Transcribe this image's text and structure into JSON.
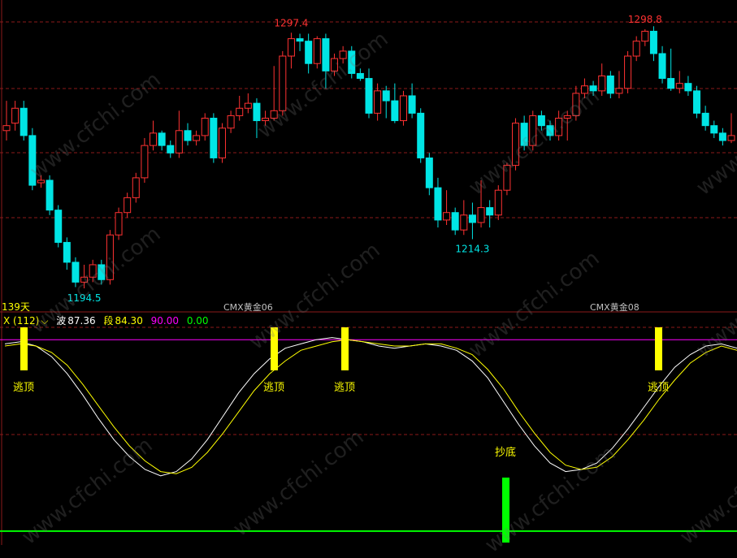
{
  "header": {
    "day_label": "139天",
    "indicator": "X (112)",
    "wave_label": "波",
    "wave_value": "87.36",
    "seg_label": "段",
    "seg_value": "84.30",
    "level_high": "90.00",
    "level_low": "0.00",
    "contracts": [
      "CMX黄金06",
      "CMX黄金08"
    ]
  },
  "watermark": "www.cfchi.com",
  "colors": {
    "up": "#ff3232",
    "down": "#00e5e5",
    "wave": "#ffffff",
    "seg": "#ffff00",
    "top_bar": "#ffff00",
    "bottom_bar": "#00ff00",
    "level90": "#ff00ff",
    "grid": "#8b1a1a"
  },
  "chart_data": [
    {
      "type": "candlestick",
      "price_labels": [
        {
          "text": "1297.4",
          "value": 1297.4,
          "kind": "high"
        },
        {
          "text": "1194.5",
          "value": 1194.5,
          "kind": "low"
        },
        {
          "text": "1214.3",
          "value": 1214.3,
          "kind": "low"
        },
        {
          "text": "1298.8",
          "value": 1298.8,
          "kind": "high"
        }
      ],
      "candles": [
        [
          1258,
          1260,
          1270,
          1254
        ],
        [
          1261,
          1267,
          1270,
          1258
        ],
        [
          1267,
          1256,
          1270,
          1254
        ],
        [
          1256,
          1236,
          1259,
          1234
        ],
        [
          1237,
          1238,
          1240,
          1235
        ],
        [
          1238,
          1226,
          1240,
          1224
        ],
        [
          1226,
          1213,
          1228,
          1211
        ],
        [
          1213,
          1205,
          1215,
          1202
        ],
        [
          1205,
          1197,
          1207,
          1195
        ],
        [
          1197,
          1199,
          1204,
          1194.5
        ],
        [
          1199,
          1204,
          1206,
          1197
        ],
        [
          1204,
          1198,
          1206,
          1196
        ],
        [
          1198,
          1216,
          1218,
          1196
        ],
        [
          1216,
          1225,
          1227,
          1214
        ],
        [
          1225,
          1231,
          1233,
          1223
        ],
        [
          1231,
          1239,
          1241,
          1229
        ],
        [
          1239,
          1252,
          1255,
          1237
        ],
        [
          1252,
          1257,
          1262,
          1250
        ],
        [
          1257,
          1252,
          1258,
          1250
        ],
        [
          1252,
          1249,
          1254,
          1247
        ],
        [
          1249,
          1258,
          1266,
          1247
        ],
        [
          1258,
          1254,
          1261,
          1252
        ],
        [
          1254,
          1256,
          1258,
          1252
        ],
        [
          1256,
          1263,
          1265,
          1254
        ],
        [
          1263,
          1247,
          1265,
          1245
        ],
        [
          1247,
          1259,
          1261,
          1245
        ],
        [
          1259,
          1264,
          1266,
          1257
        ],
        [
          1264,
          1267,
          1272,
          1262
        ],
        [
          1267,
          1269,
          1273,
          1265
        ],
        [
          1269,
          1262,
          1271,
          1255
        ],
        [
          1262,
          1263,
          1266,
          1260
        ],
        [
          1263,
          1266,
          1284,
          1262
        ],
        [
          1266,
          1288,
          1290,
          1264
        ],
        [
          1288,
          1295,
          1297.4,
          1283
        ],
        [
          1295,
          1294,
          1297,
          1290
        ],
        [
          1294,
          1285,
          1297,
          1281
        ],
        [
          1285,
          1295,
          1296,
          1283
        ],
        [
          1295,
          1282,
          1297,
          1275
        ],
        [
          1282,
          1287,
          1289,
          1280
        ],
        [
          1287,
          1290,
          1292,
          1285
        ],
        [
          1290,
          1281,
          1292,
          1279
        ],
        [
          1281,
          1279,
          1283,
          1278
        ],
        [
          1279,
          1265,
          1283,
          1263
        ],
        [
          1265,
          1274,
          1277,
          1262
        ],
        [
          1274,
          1270,
          1276,
          1263
        ],
        [
          1270,
          1262,
          1277,
          1261
        ],
        [
          1262,
          1272,
          1274,
          1260
        ],
        [
          1272,
          1265,
          1277,
          1263
        ],
        [
          1265,
          1247,
          1267,
          1245
        ],
        [
          1247,
          1235,
          1249,
          1232
        ],
        [
          1235,
          1222,
          1239,
          1219
        ],
        [
          1222,
          1225,
          1234,
          1220
        ],
        [
          1225,
          1218,
          1227,
          1216
        ],
        [
          1218,
          1224,
          1230,
          1216
        ],
        [
          1224,
          1221,
          1229,
          1214.3
        ],
        [
          1221,
          1227,
          1238,
          1219
        ],
        [
          1227,
          1224,
          1230,
          1219
        ],
        [
          1224,
          1234,
          1236,
          1222
        ],
        [
          1234,
          1244,
          1245,
          1232
        ],
        [
          1244,
          1261,
          1263,
          1242
        ],
        [
          1261,
          1252,
          1264,
          1250
        ],
        [
          1252,
          1264,
          1266,
          1250
        ],
        [
          1264,
          1260,
          1266,
          1258
        ],
        [
          1260,
          1256,
          1262,
          1254
        ],
        [
          1256,
          1263,
          1266,
          1254
        ],
        [
          1263,
          1264,
          1266,
          1254
        ],
        [
          1264,
          1273,
          1276,
          1262
        ],
        [
          1273,
          1276,
          1279,
          1271
        ],
        [
          1276,
          1274,
          1278,
          1272
        ],
        [
          1274,
          1280,
          1285,
          1272
        ],
        [
          1280,
          1273,
          1282,
          1271
        ],
        [
          1273,
          1275,
          1282,
          1271
        ],
        [
          1275,
          1288,
          1290,
          1273
        ],
        [
          1288,
          1294,
          1296,
          1286
        ],
        [
          1294,
          1298,
          1298.8,
          1292
        ],
        [
          1298,
          1289,
          1300,
          1286
        ],
        [
          1289,
          1279,
          1292,
          1277
        ],
        [
          1279,
          1275,
          1291,
          1274
        ],
        [
          1275,
          1277,
          1282,
          1273
        ],
        [
          1277,
          1274,
          1280,
          1272
        ],
        [
          1274,
          1265,
          1276,
          1263
        ],
        [
          1265,
          1260,
          1268,
          1258
        ],
        [
          1260,
          1257,
          1262,
          1255
        ],
        [
          1257,
          1254,
          1259,
          1252
        ],
        [
          1254,
          1256,
          1265,
          1253
        ]
      ]
    },
    {
      "type": "line",
      "ylim": [
        -5,
        100
      ],
      "series": [
        {
          "name": "波",
          "color": "#ffffff",
          "values": [
            88,
            89,
            87,
            82,
            74,
            64,
            53,
            43,
            35,
            29,
            26,
            28,
            34,
            43,
            54,
            65,
            74,
            81,
            86,
            88,
            90,
            91,
            90,
            89,
            87,
            86,
            87,
            88,
            87,
            85,
            80,
            72,
            61,
            50,
            40,
            32,
            28,
            29,
            32,
            39,
            48,
            58,
            68,
            77,
            83,
            87,
            88,
            86
          ]
        },
        {
          "name": "段",
          "color": "#ffff00",
          "values": [
            87,
            88,
            87,
            84,
            78,
            69,
            59,
            49,
            40,
            33,
            28,
            27,
            30,
            37,
            46,
            56,
            66,
            74,
            80,
            85,
            87,
            89,
            90,
            89,
            88,
            87,
            87,
            88,
            88,
            86,
            83,
            76,
            67,
            56,
            46,
            37,
            31,
            29,
            30,
            35,
            43,
            52,
            62,
            71,
            79,
            84,
            87,
            85
          ]
        }
      ],
      "signals": [
        {
          "label": "逃顶",
          "type": "top"
        },
        {
          "label": "逃顶",
          "type": "top"
        },
        {
          "label": "逃顶",
          "type": "top"
        },
        {
          "label": "抄底",
          "type": "bottom"
        },
        {
          "label": "逃顶",
          "type": "top"
        }
      ]
    }
  ]
}
